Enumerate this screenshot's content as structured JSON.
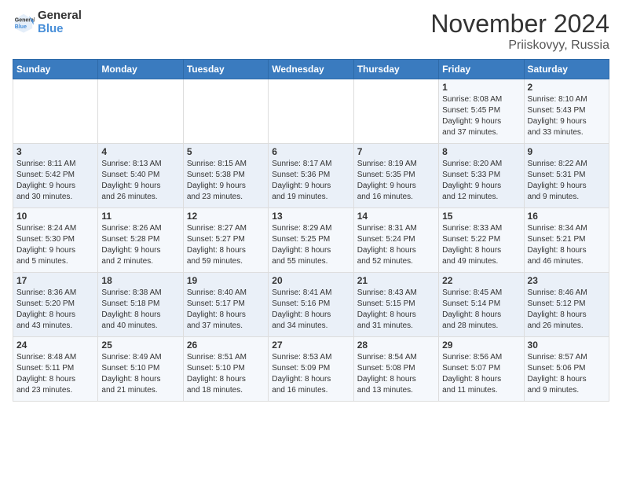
{
  "header": {
    "logo_line1": "General",
    "logo_line2": "Blue",
    "month": "November 2024",
    "location": "Priiskovyy, Russia"
  },
  "days_of_week": [
    "Sunday",
    "Monday",
    "Tuesday",
    "Wednesday",
    "Thursday",
    "Friday",
    "Saturday"
  ],
  "weeks": [
    [
      {
        "day": "",
        "info": ""
      },
      {
        "day": "",
        "info": ""
      },
      {
        "day": "",
        "info": ""
      },
      {
        "day": "",
        "info": ""
      },
      {
        "day": "",
        "info": ""
      },
      {
        "day": "1",
        "info": "Sunrise: 8:08 AM\nSunset: 5:45 PM\nDaylight: 9 hours\nand 37 minutes."
      },
      {
        "day": "2",
        "info": "Sunrise: 8:10 AM\nSunset: 5:43 PM\nDaylight: 9 hours\nand 33 minutes."
      }
    ],
    [
      {
        "day": "3",
        "info": "Sunrise: 8:11 AM\nSunset: 5:42 PM\nDaylight: 9 hours\nand 30 minutes."
      },
      {
        "day": "4",
        "info": "Sunrise: 8:13 AM\nSunset: 5:40 PM\nDaylight: 9 hours\nand 26 minutes."
      },
      {
        "day": "5",
        "info": "Sunrise: 8:15 AM\nSunset: 5:38 PM\nDaylight: 9 hours\nand 23 minutes."
      },
      {
        "day": "6",
        "info": "Sunrise: 8:17 AM\nSunset: 5:36 PM\nDaylight: 9 hours\nand 19 minutes."
      },
      {
        "day": "7",
        "info": "Sunrise: 8:19 AM\nSunset: 5:35 PM\nDaylight: 9 hours\nand 16 minutes."
      },
      {
        "day": "8",
        "info": "Sunrise: 8:20 AM\nSunset: 5:33 PM\nDaylight: 9 hours\nand 12 minutes."
      },
      {
        "day": "9",
        "info": "Sunrise: 8:22 AM\nSunset: 5:31 PM\nDaylight: 9 hours\nand 9 minutes."
      }
    ],
    [
      {
        "day": "10",
        "info": "Sunrise: 8:24 AM\nSunset: 5:30 PM\nDaylight: 9 hours\nand 5 minutes."
      },
      {
        "day": "11",
        "info": "Sunrise: 8:26 AM\nSunset: 5:28 PM\nDaylight: 9 hours\nand 2 minutes."
      },
      {
        "day": "12",
        "info": "Sunrise: 8:27 AM\nSunset: 5:27 PM\nDaylight: 8 hours\nand 59 minutes."
      },
      {
        "day": "13",
        "info": "Sunrise: 8:29 AM\nSunset: 5:25 PM\nDaylight: 8 hours\nand 55 minutes."
      },
      {
        "day": "14",
        "info": "Sunrise: 8:31 AM\nSunset: 5:24 PM\nDaylight: 8 hours\nand 52 minutes."
      },
      {
        "day": "15",
        "info": "Sunrise: 8:33 AM\nSunset: 5:22 PM\nDaylight: 8 hours\nand 49 minutes."
      },
      {
        "day": "16",
        "info": "Sunrise: 8:34 AM\nSunset: 5:21 PM\nDaylight: 8 hours\nand 46 minutes."
      }
    ],
    [
      {
        "day": "17",
        "info": "Sunrise: 8:36 AM\nSunset: 5:20 PM\nDaylight: 8 hours\nand 43 minutes."
      },
      {
        "day": "18",
        "info": "Sunrise: 8:38 AM\nSunset: 5:18 PM\nDaylight: 8 hours\nand 40 minutes."
      },
      {
        "day": "19",
        "info": "Sunrise: 8:40 AM\nSunset: 5:17 PM\nDaylight: 8 hours\nand 37 minutes."
      },
      {
        "day": "20",
        "info": "Sunrise: 8:41 AM\nSunset: 5:16 PM\nDaylight: 8 hours\nand 34 minutes."
      },
      {
        "day": "21",
        "info": "Sunrise: 8:43 AM\nSunset: 5:15 PM\nDaylight: 8 hours\nand 31 minutes."
      },
      {
        "day": "22",
        "info": "Sunrise: 8:45 AM\nSunset: 5:14 PM\nDaylight: 8 hours\nand 28 minutes."
      },
      {
        "day": "23",
        "info": "Sunrise: 8:46 AM\nSunset: 5:12 PM\nDaylight: 8 hours\nand 26 minutes."
      }
    ],
    [
      {
        "day": "24",
        "info": "Sunrise: 8:48 AM\nSunset: 5:11 PM\nDaylight: 8 hours\nand 23 minutes."
      },
      {
        "day": "25",
        "info": "Sunrise: 8:49 AM\nSunset: 5:10 PM\nDaylight: 8 hours\nand 21 minutes."
      },
      {
        "day": "26",
        "info": "Sunrise: 8:51 AM\nSunset: 5:10 PM\nDaylight: 8 hours\nand 18 minutes."
      },
      {
        "day": "27",
        "info": "Sunrise: 8:53 AM\nSunset: 5:09 PM\nDaylight: 8 hours\nand 16 minutes."
      },
      {
        "day": "28",
        "info": "Sunrise: 8:54 AM\nSunset: 5:08 PM\nDaylight: 8 hours\nand 13 minutes."
      },
      {
        "day": "29",
        "info": "Sunrise: 8:56 AM\nSunset: 5:07 PM\nDaylight: 8 hours\nand 11 minutes."
      },
      {
        "day": "30",
        "info": "Sunrise: 8:57 AM\nSunset: 5:06 PM\nDaylight: 8 hours\nand 9 minutes."
      }
    ]
  ]
}
